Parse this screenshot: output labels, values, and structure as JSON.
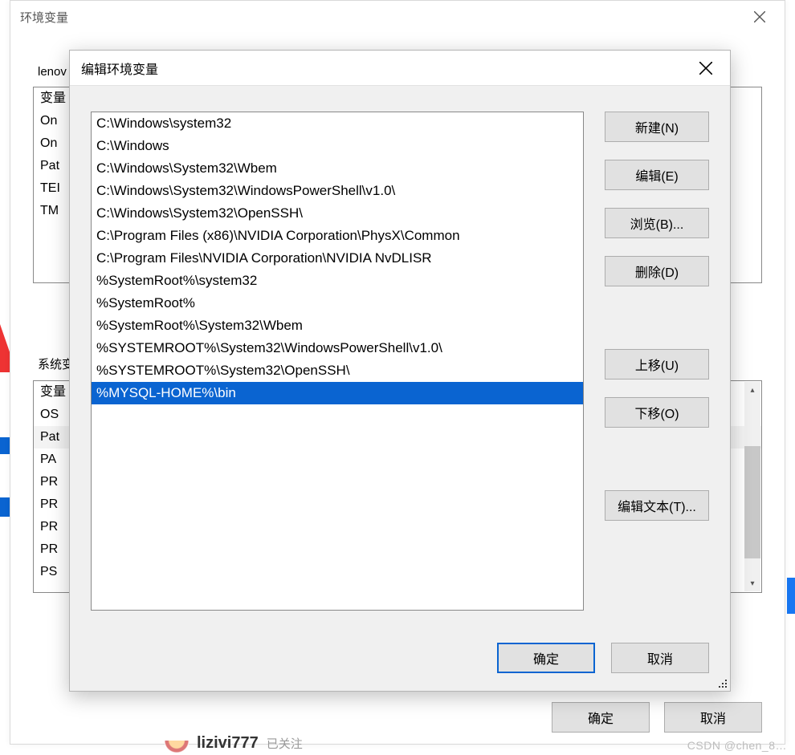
{
  "env_window": {
    "title": "环境变量",
    "user_section_label": "lenov",
    "user_rows": [
      "变量",
      "On",
      "On",
      "Pat",
      "TEI",
      "TM"
    ],
    "sys_section_label": "系统变",
    "sys_rows": [
      "变量",
      "OS",
      "Pat",
      "PA",
      "PR",
      "PR",
      "PR",
      "PR",
      "PS"
    ],
    "sys_selected_index": 2,
    "ok": "确定",
    "cancel": "取消"
  },
  "edit_dialog": {
    "title": "编辑环境变量",
    "paths": [
      "C:\\Windows\\system32",
      "C:\\Windows",
      "C:\\Windows\\System32\\Wbem",
      "C:\\Windows\\System32\\WindowsPowerShell\\v1.0\\",
      "C:\\Windows\\System32\\OpenSSH\\",
      "C:\\Program Files (x86)\\NVIDIA Corporation\\PhysX\\Common",
      "C:\\Program Files\\NVIDIA Corporation\\NVIDIA NvDLISR",
      "%SystemRoot%\\system32",
      "%SystemRoot%",
      "%SystemRoot%\\System32\\Wbem",
      "%SYSTEMROOT%\\System32\\WindowsPowerShell\\v1.0\\",
      "%SYSTEMROOT%\\System32\\OpenSSH\\",
      "%MYSQL-HOME%\\bin"
    ],
    "selected_index": 12,
    "buttons": {
      "new": "新建(N)",
      "edit": "编辑(E)",
      "browse": "浏览(B)...",
      "delete": "删除(D)",
      "move_up": "上移(U)",
      "move_down": "下移(O)",
      "edit_text": "编辑文本(T)...",
      "ok": "确定",
      "cancel": "取消"
    }
  },
  "misc": {
    "watermark": "CSDN @chen_8…",
    "username_fragment": "lizivi777",
    "label_fragment": "(U)",
    "follow_fragment": "已关注"
  }
}
